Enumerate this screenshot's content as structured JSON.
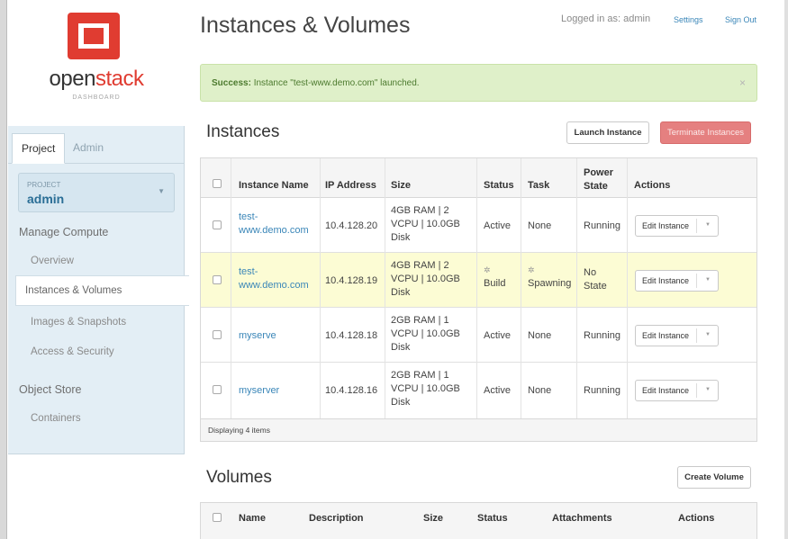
{
  "sidebar": {
    "logo_text_a": "open",
    "logo_text_b": "stack",
    "logo_sub": "DASHBOARD",
    "tabs": [
      "Project",
      "Admin"
    ],
    "project_label": "PROJECT",
    "project_name": "admin",
    "sections": [
      {
        "heading": "Manage Compute",
        "items": [
          "Overview",
          "Instances & Volumes",
          "Images & Snapshots",
          "Access & Security"
        ]
      },
      {
        "heading": "Object Store",
        "items": [
          "Containers"
        ]
      }
    ]
  },
  "header": {
    "title": "Instances & Volumes",
    "logged_in": "Logged in as: admin",
    "settings": "Settings",
    "sign_out": "Sign Out"
  },
  "alert": {
    "strong": "Success:",
    "message": " Instance \"test-www.demo.com\" launched.",
    "close": "×"
  },
  "instances": {
    "title": "Instances",
    "launch_button": "Launch Instance",
    "terminate_button": "Terminate Instances",
    "columns": [
      "Instance Name",
      "IP Address",
      "Size",
      "Status",
      "Task",
      "Power State",
      "Actions"
    ],
    "rows": [
      {
        "name": "test-www.demo.com",
        "ip": "10.4.128.20",
        "size": "4GB RAM | 2 VCPU | 10.0GB Disk",
        "status": "Active",
        "task": "None",
        "power": "Running",
        "action": "Edit Instance"
      },
      {
        "name": "test-www.demo.com",
        "ip": "10.4.128.19",
        "size": "4GB RAM | 2 VCPU | 10.0GB Disk",
        "status": "Build",
        "task": "Spawning",
        "power": "No State",
        "action": "Edit Instance"
      },
      {
        "name": "myserve",
        "ip": "10.4.128.18",
        "size": "2GB RAM | 1 VCPU | 10.0GB Disk",
        "status": "Active",
        "task": "None",
        "power": "Running",
        "action": "Edit Instance"
      },
      {
        "name": "myserver",
        "ip": "10.4.128.16",
        "size": "2GB RAM | 1 VCPU | 10.0GB Disk",
        "status": "Active",
        "task": "None",
        "power": "Running",
        "action": "Edit Instance"
      }
    ],
    "footer": "Displaying 4 items"
  },
  "volumes": {
    "title": "Volumes",
    "create_button": "Create Volume",
    "columns": [
      "Name",
      "Description",
      "Size",
      "Status",
      "Attachments",
      "Actions"
    ]
  },
  "colors": {
    "brand": "#e03c31",
    "link": "#3a86b8",
    "danger": "#e58080",
    "success_bg": "#dff0c9"
  }
}
